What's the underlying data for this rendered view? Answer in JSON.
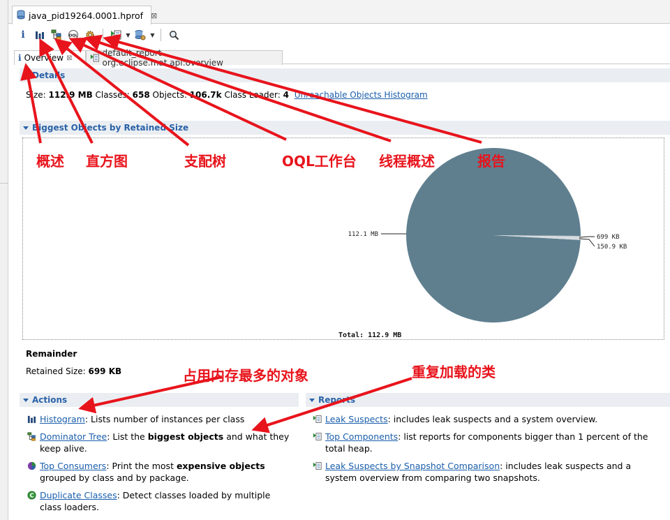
{
  "file_tab": {
    "label": "java_pid19264.0001.hprof",
    "close": "⊠"
  },
  "toolbar": {
    "items": [
      "overview-info",
      "histogram",
      "dominator-tree",
      "oql",
      "thread-overview",
      "run-report",
      "query-browser",
      "search"
    ]
  },
  "sub_tabs": [
    {
      "label": "Overview",
      "close": "⊠"
    },
    {
      "label": "default_report  org.eclipse.mat.api:overview"
    }
  ],
  "details": {
    "heading": "Details",
    "size_label": "Size: ",
    "size_value": "112.9 MB",
    "classes_label": " Classes: ",
    "classes_value": "658",
    "objects_label": " Objects: ",
    "objects_value": "106.7k",
    "loader_label": " Class Loader: ",
    "loader_value": "4",
    "link": "Unreachable Objects Histogram"
  },
  "biggest": {
    "heading": "Biggest Objects by Retained Size"
  },
  "chart_data": {
    "type": "pie",
    "categories": [
      "112.1 MB",
      "699 KB",
      "150.9 KB"
    ],
    "values": [
      112.1,
      0.699,
      0.151
    ],
    "units": "MB",
    "total_label": "Total:  112.9 MB",
    "colors": [
      "#5f7f8f",
      "#d7dcdf",
      "#b9c1c6"
    ]
  },
  "remainder": {
    "title": "Remainder",
    "retained_label": "Retained Size: ",
    "retained_value": "699 KB"
  },
  "actions": {
    "heading": "Actions",
    "items": [
      {
        "link": "Histogram",
        "text_a": ": Lists number of instances per class",
        "bold": "",
        "text_b": ""
      },
      {
        "link": "Dominator Tree",
        "text_a": ": List the ",
        "bold": "biggest objects",
        "text_b": " and what they keep alive."
      },
      {
        "link": "Top Consumers",
        "text_a": ": Print the most ",
        "bold": "expensive objects",
        "text_b": " grouped by class and by package."
      },
      {
        "link": "Duplicate Classes",
        "text_a": ": Detect classes loaded by multiple class loaders.",
        "bold": "",
        "text_b": ""
      }
    ]
  },
  "reports": {
    "heading": "Reports",
    "items": [
      {
        "link": "Leak Suspects",
        "text": ": includes leak suspects and a system overview."
      },
      {
        "link": "Top Components",
        "text": ": list reports for components bigger than 1 percent of the total heap."
      },
      {
        "link": "Leak Suspects by Snapshot Comparison",
        "text": ": includes leak suspects and a system overview from comparing two snapshots."
      }
    ]
  },
  "annotations": {
    "overview": "概述",
    "histogram": "直方图",
    "dominator": "支配树",
    "oql": "OQL工作台",
    "thread": "线程概述",
    "report": "报告",
    "biggest": "占用内存最多的对象",
    "duplicate": "重复加载的类",
    "color": "#e8141c"
  }
}
